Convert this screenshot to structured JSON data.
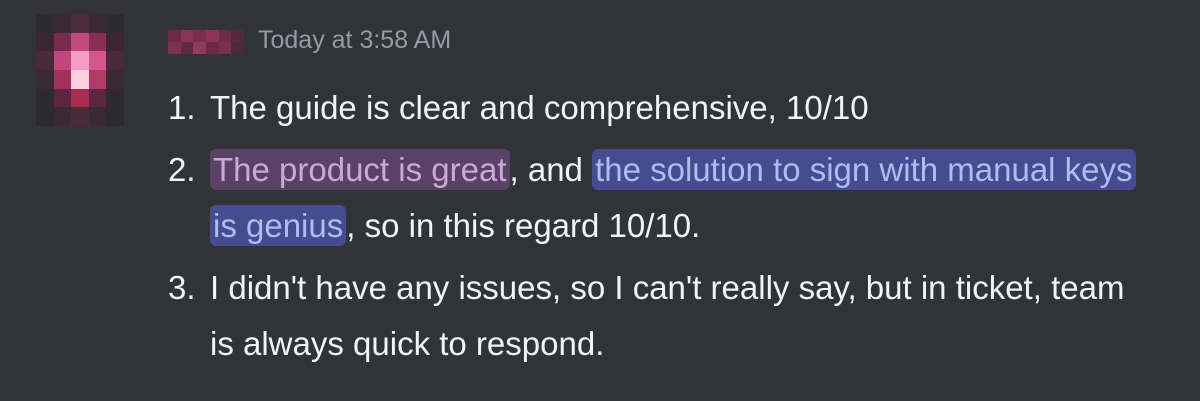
{
  "message": {
    "timestamp": "Today at 3:58 AM",
    "items": [
      {
        "number": "1.",
        "text": "The guide is clear and comprehensive, 10/10"
      },
      {
        "number": "2.",
        "highlight_1": "The product is great",
        "middle_1": ", and ",
        "highlight_2": "the solution to sign with manual keys is genius",
        "tail": ", so in this regard 10/10."
      },
      {
        "number": "3.",
        "text": "I didn't have any issues, so I can't really say, but in ticket, team is always quick to respond."
      }
    ]
  },
  "colors": {
    "background": "#313338",
    "text": "#f2f3f5",
    "timestamp": "#949ba4",
    "highlight_purple_bg": "#5a4266",
    "highlight_blue_bg": "#454c8f"
  }
}
